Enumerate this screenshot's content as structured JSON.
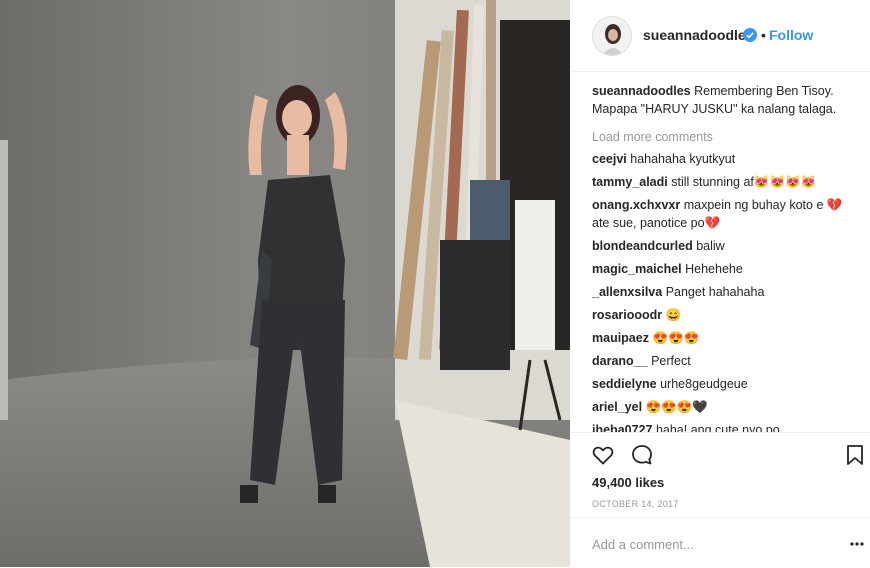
{
  "post": {
    "username": "sueannadoodles",
    "dot": "•",
    "follow_label": "Follow",
    "caption": "Remembering Ben Tisoy. Mapapa \"HARUY JUSKU\" ka nalang talaga.",
    "load_more": "Load more comments",
    "comments": [
      {
        "user": "ceejvi",
        "text": "hahahaha kyutkyut"
      },
      {
        "user": "tammy_aladi",
        "text": "still stunning af😻😻😻😻"
      },
      {
        "user": "onang.xchxvxr",
        "text": "maxpein ng buhay koto e 💔ate sue, panotice po💔"
      },
      {
        "user": "blondeandcurled",
        "text": "baliw"
      },
      {
        "user": "magic_maichel",
        "text": "Hehehehe"
      },
      {
        "user": "_allenxsilva",
        "text": "Panget hahahaha"
      },
      {
        "user": "rosariooodr",
        "text": "😄"
      },
      {
        "user": "mauipaez",
        "text": "😍😍😍"
      },
      {
        "user": "darano__",
        "text": "Perfect"
      },
      {
        "user": "seddielyne",
        "text": "urhe8geudgeue"
      },
      {
        "user": "ariel_yel",
        "text": "😍😍😍🖤"
      },
      {
        "user": "iheba0727",
        "text": "haha! ang cute nyo po"
      }
    ],
    "likes": "49,400 likes",
    "date": "OCTOBER 14, 2017",
    "add_comment_placeholder": "Add a comment..."
  },
  "colors": {
    "link": "#3897f0",
    "text": "#262626",
    "muted": "#999999"
  },
  "icons": [
    "verified-badge-icon",
    "heart-icon",
    "comment-icon",
    "bookmark-icon",
    "more-options-icon"
  ]
}
